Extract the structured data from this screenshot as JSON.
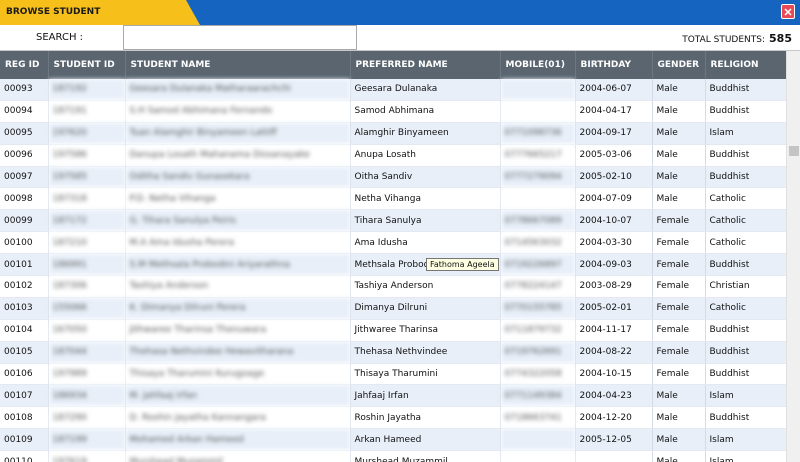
{
  "window": {
    "title": "BROWSE STUDENT"
  },
  "search": {
    "label": "SEARCH  :",
    "value": "",
    "placeholder": ""
  },
  "total": {
    "label": "TOTAL STUDENTS:",
    "value": "585"
  },
  "columns": [
    "REG ID",
    "STUDENT ID",
    "STUDENT NAME",
    "PREFERRED NAME",
    "MOBILE(01)",
    "BIRTHDAY",
    "GENDER",
    "RELIGION"
  ],
  "rows": [
    {
      "reg": "00093",
      "sid": "187192",
      "name": "Geesara Dulanaka Matharaarachchi",
      "pref": "Geesara Dulanaka",
      "mobile": "",
      "bday": "2004-06-07",
      "gender": "Male",
      "rel": "Buddhist"
    },
    {
      "reg": "00094",
      "sid": "187191",
      "name": "S.H Samod Abhimana Fernando",
      "pref": "Samod Abhimana",
      "mobile": "",
      "bday": "2004-04-17",
      "gender": "Male",
      "rel": "Buddhist"
    },
    {
      "reg": "00095",
      "sid": "197620",
      "name": "Tuan Alamghir Binyameen Lattiff",
      "pref": "Alamghir Binyameen",
      "mobile": "0771098736",
      "bday": "2004-09-17",
      "gender": "Male",
      "rel": "Islam"
    },
    {
      "reg": "00096",
      "sid": "197586",
      "name": "Danupa Losath Mahanama Dissanayake",
      "pref": "Anupa Losath",
      "mobile": "0777665217",
      "bday": "2005-03-06",
      "gender": "Male",
      "rel": "Buddhist"
    },
    {
      "reg": "00097",
      "sid": "197585",
      "name": "Oditha Sandiv Gunasekara",
      "pref": "Oitha Sandiv",
      "mobile": "0777279094",
      "bday": "2005-02-10",
      "gender": "Male",
      "rel": "Buddhist"
    },
    {
      "reg": "00098",
      "sid": "187318",
      "name": "P.D. Netha Vihanga",
      "pref": "Netha Vihanga",
      "mobile": "",
      "bday": "2004-07-09",
      "gender": "Male",
      "rel": "Catholic"
    },
    {
      "reg": "00099",
      "sid": "187172",
      "name": "G. Tihara Sanulya Peiris",
      "pref": "Tihara Sanulya",
      "mobile": "0778667089",
      "bday": "2004-10-07",
      "gender": "Female",
      "rel": "Catholic"
    },
    {
      "reg": "00100",
      "sid": "187210",
      "name": "M.A Ama Idusha Perera",
      "pref": "Ama Idusha",
      "mobile": "0714563032",
      "bday": "2004-03-30",
      "gender": "Female",
      "rel": "Catholic"
    },
    {
      "reg": "00101",
      "sid": "186991",
      "name": "S.M Methsala Probodini Ariyarathna",
      "pref": "Methsala Probod",
      "mobile": "0719226897",
      "bday": "2004-09-03",
      "gender": "Female",
      "rel": "Buddhist"
    },
    {
      "reg": "00102",
      "sid": "187306",
      "name": "Tashiya Anderson",
      "pref": "Tashiya Anderson",
      "mobile": "0778224147",
      "bday": "2003-08-29",
      "gender": "Female",
      "rel": "Christian"
    },
    {
      "reg": "00103",
      "sid": "155066",
      "name": "K. Dimanya Dilruni Perera",
      "pref": "Dimanya Dilruni",
      "mobile": "0770155785",
      "bday": "2005-02-01",
      "gender": "Female",
      "rel": "Catholic"
    },
    {
      "reg": "00104",
      "sid": "167050",
      "name": "Jithwaree Tharinsa Thenuwara",
      "pref": "Jithwaree Tharinsa",
      "mobile": "0711879732",
      "bday": "2004-11-17",
      "gender": "Female",
      "rel": "Buddhist"
    },
    {
      "reg": "00105",
      "sid": "187044",
      "name": "Thehasa Nethvindee Hewavitharana",
      "pref": "Thehasa Nethvindee",
      "mobile": "0719762691",
      "bday": "2004-08-22",
      "gender": "Female",
      "rel": "Buddhist"
    },
    {
      "reg": "00106",
      "sid": "197989",
      "name": "Thisaya Tharumini Kurugoage",
      "pref": "Thisaya Tharumini",
      "mobile": "0774322058",
      "bday": "2004-10-15",
      "gender": "Female",
      "rel": "Buddhist"
    },
    {
      "reg": "00107",
      "sid": "186934",
      "name": "M. Jahfaaj Irfan",
      "pref": "Jahfaaj Irfan",
      "mobile": "0771149384",
      "bday": "2004-04-23",
      "gender": "Male",
      "rel": "Islam"
    },
    {
      "reg": "00108",
      "sid": "187290",
      "name": "D. Roshin Jayatha Kannangara",
      "pref": "Roshin Jayatha",
      "mobile": "0718663741",
      "bday": "2004-12-20",
      "gender": "Male",
      "rel": "Buddhist"
    },
    {
      "reg": "00109",
      "sid": "187199",
      "name": "Mohamed Arkan Hameed",
      "pref": "Arkan Hameed",
      "mobile": "",
      "bday": "2005-12-05",
      "gender": "Male",
      "rel": "Islam"
    },
    {
      "reg": "00110",
      "sid": "197619",
      "name": "Murshead Muzammil",
      "pref": "Murshead Muzammil",
      "mobile": "",
      "bday": "",
      "gender": "Male",
      "rel": "Islam"
    }
  ],
  "tooltip": {
    "text": "Fathoma Ageela"
  }
}
